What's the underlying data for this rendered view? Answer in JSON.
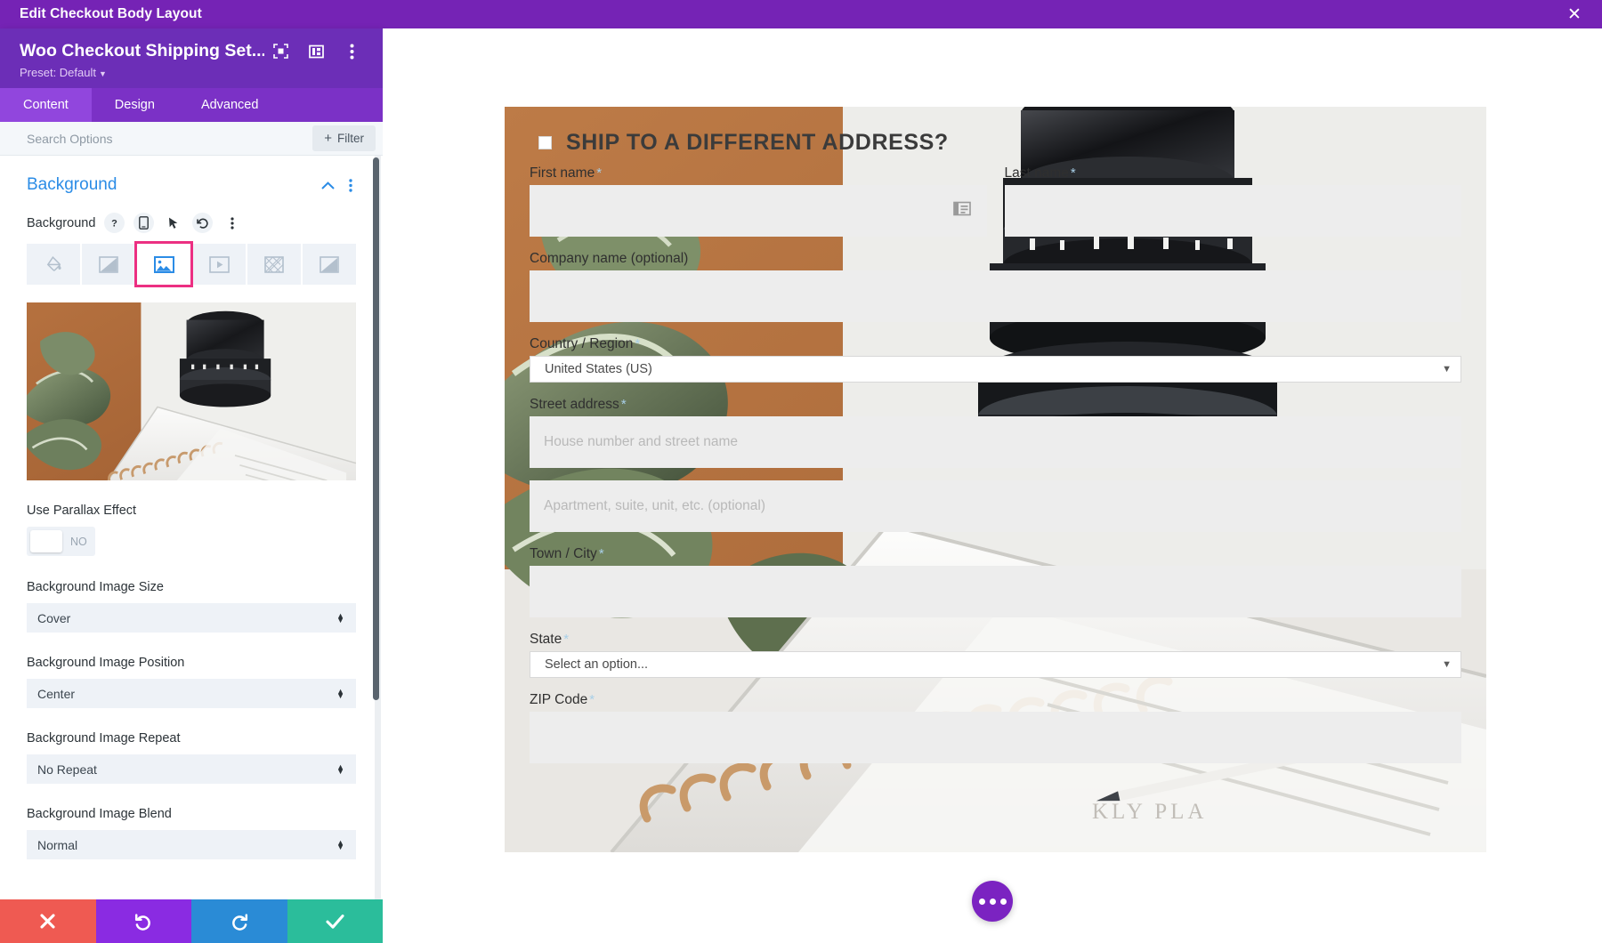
{
  "window": {
    "title": "Edit Checkout Body Layout",
    "close_icon": "close-icon",
    "close_label": "✕"
  },
  "panel": {
    "module_name": "Woo Checkout Shipping Set...",
    "preset_label": "Preset: Default",
    "header_icons": [
      {
        "name": "focus-module-icon",
        "glyph": "⬚"
      },
      {
        "name": "layout-columns-icon",
        "glyph": "▤"
      },
      {
        "name": "more-options-icon",
        "glyph": "⋮"
      }
    ],
    "tabs": [
      {
        "label": "Content",
        "active": true
      },
      {
        "label": "Design",
        "active": false
      },
      {
        "label": "Advanced",
        "active": false
      }
    ],
    "search": {
      "placeholder": "Search Options",
      "value": ""
    },
    "filter_button": {
      "label": "Filter",
      "plus": "+"
    },
    "section": {
      "title": "Background",
      "collapse_icon": "chevron-up-icon",
      "menu_icon": "more-options-icon"
    },
    "background_field": {
      "label": "Background",
      "mini_icons": [
        {
          "name": "help-icon",
          "glyph": "?"
        },
        {
          "name": "responsive-mobile-icon",
          "glyph": "▯"
        },
        {
          "name": "hover-cursor-icon",
          "glyph": "➤"
        },
        {
          "name": "reset-icon",
          "glyph": "↺"
        },
        {
          "name": "more-options-icon",
          "glyph": "⋮"
        }
      ],
      "types": [
        {
          "name": "background-color-tab",
          "icon": "paint-bucket-icon",
          "selected": false
        },
        {
          "name": "background-gradient-tab",
          "icon": "gradient-icon",
          "selected": false
        },
        {
          "name": "background-image-tab",
          "icon": "image-icon",
          "selected": true
        },
        {
          "name": "background-video-tab",
          "icon": "video-icon",
          "selected": false
        },
        {
          "name": "background-pattern-tab",
          "icon": "pattern-icon",
          "selected": false
        },
        {
          "name": "background-mask-tab",
          "icon": "mask-icon",
          "selected": false
        }
      ]
    },
    "controls": [
      {
        "label": "Use Parallax Effect",
        "type": "toggle",
        "value": "NO"
      },
      {
        "label": "Background Image Size",
        "type": "select",
        "value": "Cover"
      },
      {
        "label": "Background Image Position",
        "type": "select",
        "value": "Center"
      },
      {
        "label": "Background Image Repeat",
        "type": "select",
        "value": "No Repeat"
      },
      {
        "label": "Background Image Blend",
        "type": "select",
        "value": "Normal"
      }
    ],
    "actions": [
      {
        "name": "cancel-button",
        "icon": "close-icon",
        "glyph": "✕",
        "color": "#ef5a52"
      },
      {
        "name": "undo-button",
        "icon": "undo-icon",
        "glyph": "↺",
        "color": "#8a2be2"
      },
      {
        "name": "redo-button",
        "icon": "redo-icon",
        "glyph": "↻",
        "color": "#2a8bd6"
      },
      {
        "name": "save-button",
        "icon": "check-icon",
        "glyph": "✓",
        "color": "#2bbd9b"
      }
    ]
  },
  "preview": {
    "heading": "SHIP TO A DIFFERENT ADDRESS?",
    "checkbox_checked": false,
    "fields": {
      "first_name": {
        "label": "First name",
        "required": "*",
        "value": "",
        "placeholder": ""
      },
      "last_name": {
        "label": "Last name",
        "required": "*",
        "value": "",
        "placeholder": ""
      },
      "company": {
        "label": "Company name (optional)",
        "required": "",
        "value": "",
        "placeholder": ""
      },
      "country": {
        "label": "Country / Region",
        "required": "*",
        "value": "United States (US)"
      },
      "street": {
        "label": "Street address",
        "required": "*",
        "placeholder": "House number and street name"
      },
      "street2": {
        "label": "",
        "required": "",
        "placeholder": "Apartment, suite, unit, etc. (optional)"
      },
      "city": {
        "label": "Town / City",
        "required": "*",
        "value": "",
        "placeholder": ""
      },
      "state": {
        "label": "State",
        "required": "*",
        "value": "Select an option..."
      },
      "zip": {
        "label": "ZIP Code",
        "required": "*",
        "value": "",
        "placeholder": ""
      }
    },
    "fab": {
      "name": "page-settings-button",
      "icon": "ellipsis-icon"
    }
  },
  "colors": {
    "brand_purple": "#6c2eb7",
    "topbar_purple": "#7523b5",
    "tab_active": "#9146dd",
    "accent_blue": "#2b8ce6",
    "selected_pink": "#ec2f82",
    "save_green": "#2bbd9b",
    "cancel_red": "#ef5a52",
    "redo_blue": "#2a8bd6"
  }
}
